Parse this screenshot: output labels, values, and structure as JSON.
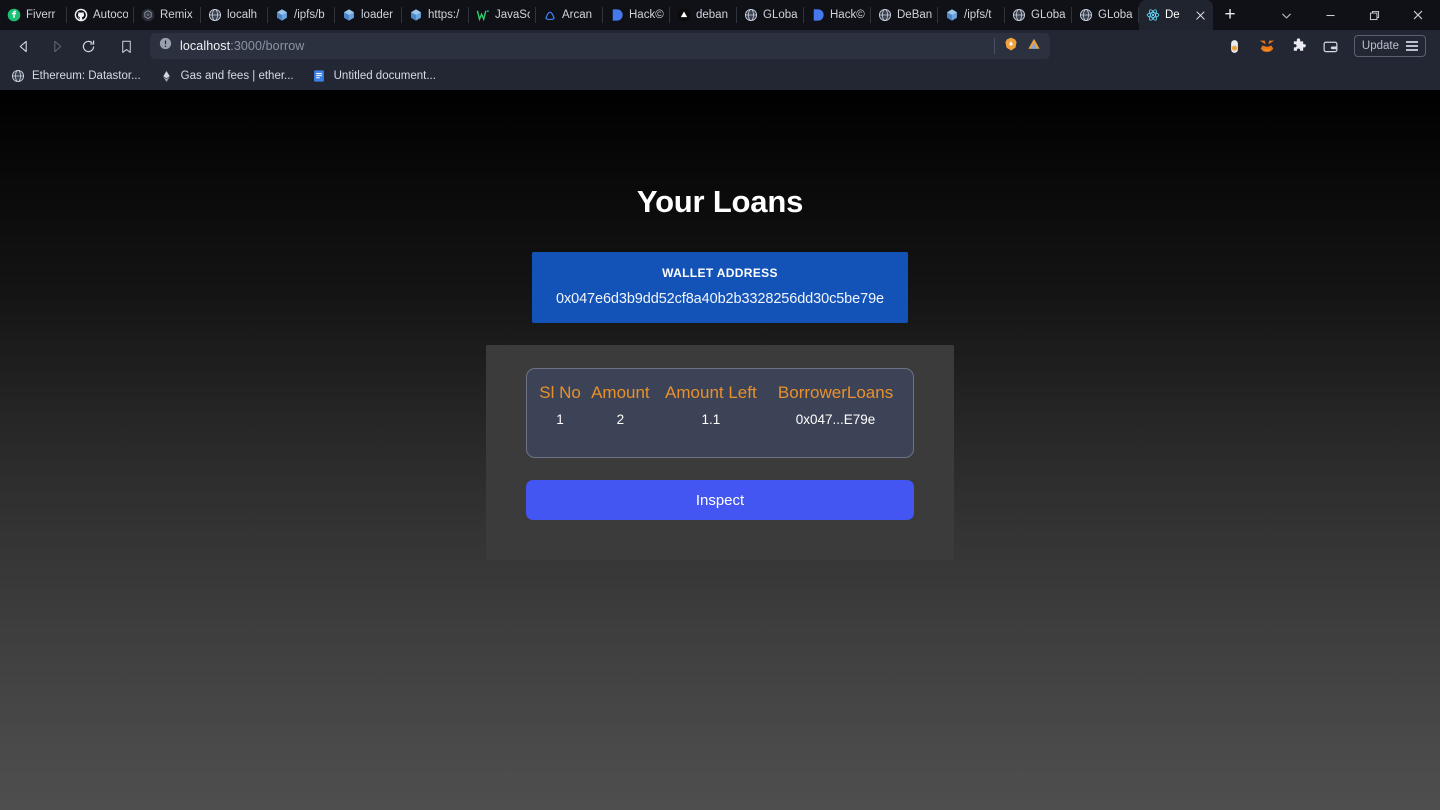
{
  "browser": {
    "tabs": [
      {
        "label": "Fiverr",
        "icon": "fiverr-icon"
      },
      {
        "label": "Autoco",
        "icon": "github-icon"
      },
      {
        "label": "Remix",
        "icon": "remix-icon"
      },
      {
        "label": "localh",
        "icon": "globe-icon"
      },
      {
        "label": "/ipfs/b",
        "icon": "ipfs-cube-icon"
      },
      {
        "label": "loader",
        "icon": "ipfs-cube-icon"
      },
      {
        "label": "https:/",
        "icon": "ipfs-cube-icon"
      },
      {
        "label": "JavaSc",
        "icon": "w3schools-icon"
      },
      {
        "label": "Arcan",
        "icon": "arcana-icon"
      },
      {
        "label": "Hack©",
        "icon": "hackerearth-icon"
      },
      {
        "label": "deban",
        "icon": "vercel-icon"
      },
      {
        "label": "GLoba",
        "icon": "globe-icon"
      },
      {
        "label": "Hack©",
        "icon": "hackerearth-icon"
      },
      {
        "label": "DeBan",
        "icon": "globe-icon"
      },
      {
        "label": "/ipfs/t",
        "icon": "ipfs-cube-icon"
      },
      {
        "label": "GLoba",
        "icon": "globe-icon"
      },
      {
        "label": "GLoba",
        "icon": "globe-icon"
      }
    ],
    "active_tab": {
      "label": "De",
      "icon": "react-icon",
      "close_label": "×"
    },
    "new_tab_label": "+",
    "window_controls": {
      "chevron": "chevron-down-icon",
      "minimize": "minimize-icon",
      "restore": "restore-icon",
      "close": "close-icon"
    },
    "toolbar": {
      "back": "back-icon",
      "forward": "forward-icon",
      "reload": "reload-icon",
      "bookmark": "bookmark-icon",
      "url_host": "localhost",
      "url_path": ":3000/borrow",
      "site_info_icon": "info-circle-icon",
      "brave_shields_icon": "brave-lion-icon",
      "brave_rewards_icon": "brave-rewards-icon",
      "extensions": [
        "brave-wallet-icon",
        "metamask-fox-icon",
        "puzzle-icon",
        "wallet-icon"
      ],
      "update_label": "Update",
      "menu_icon": "hamburger-menu-icon"
    },
    "bookmarks": [
      {
        "label": "Ethereum: Datastor...",
        "icon": "globe-icon"
      },
      {
        "label": "Gas and fees | ether...",
        "icon": "ethereum-icon"
      },
      {
        "label": "Untitled document...",
        "icon": "google-docs-icon"
      }
    ]
  },
  "page": {
    "title": "Your Loans",
    "wallet": {
      "label": "WALLET ADDRESS",
      "address": "0x047e6d3b9dd52cf8a40b2b3328256dd30c5be79e"
    },
    "loans_table": {
      "columns": [
        "Sl No",
        "Amount",
        "Amount Left",
        "BorrowerLoans"
      ],
      "rows": [
        {
          "sl_no": "1",
          "amount": "2",
          "amount_left": "1.1",
          "borrower": "0x047...E79e"
        }
      ]
    },
    "inspect_button_label": "Inspect"
  },
  "colors": {
    "accent_blue": "#4356f1",
    "wallet_blue": "#1353b7",
    "table_header_orange": "#e8912a",
    "panel_gray": "#3b3b3b",
    "table_card": "#3d4356"
  }
}
